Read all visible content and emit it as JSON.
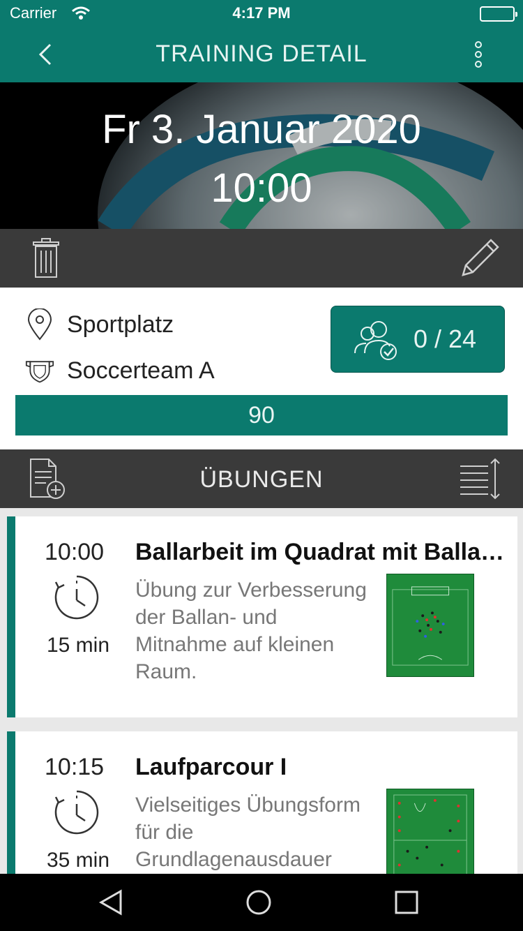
{
  "status_bar": {
    "carrier": "Carrier",
    "time": "4:17 PM"
  },
  "nav": {
    "title": "TRAINING DETAIL",
    "back_icon": "chevron-left-icon",
    "more_icon": "more-vert-icon"
  },
  "hero": {
    "date": "Fr 3. Januar 2020",
    "time": "10:00"
  },
  "actions": {
    "delete_icon": "trash-icon",
    "edit_icon": "pencil-icon"
  },
  "info": {
    "location": "Sportplatz",
    "team": "Soccerteam A",
    "participants": "0 / 24",
    "duration": "90"
  },
  "section": {
    "title": "ÜBUNGEN",
    "add_icon": "add-document-icon",
    "sort_icon": "sort-icon"
  },
  "exercises": [
    {
      "start": "10:00",
      "title": "Ballarbeit im Quadrat mit Ballan- und Mitnahme",
      "duration": "15 min",
      "description": "Übung zur Verbesserung der Ballan- und Mitnahme auf kleinen Raum."
    },
    {
      "start": "10:15",
      "title": "Laufparcour I",
      "duration": "35 min",
      "description": "Vielseitiges Übungsform für die Grundlagenausdauer"
    }
  ],
  "colors": {
    "primary": "#0b7a6e",
    "dark_bar": "#3a3a3a",
    "list_bg": "#e8e8e8",
    "field_green": "#1f8b3b"
  }
}
